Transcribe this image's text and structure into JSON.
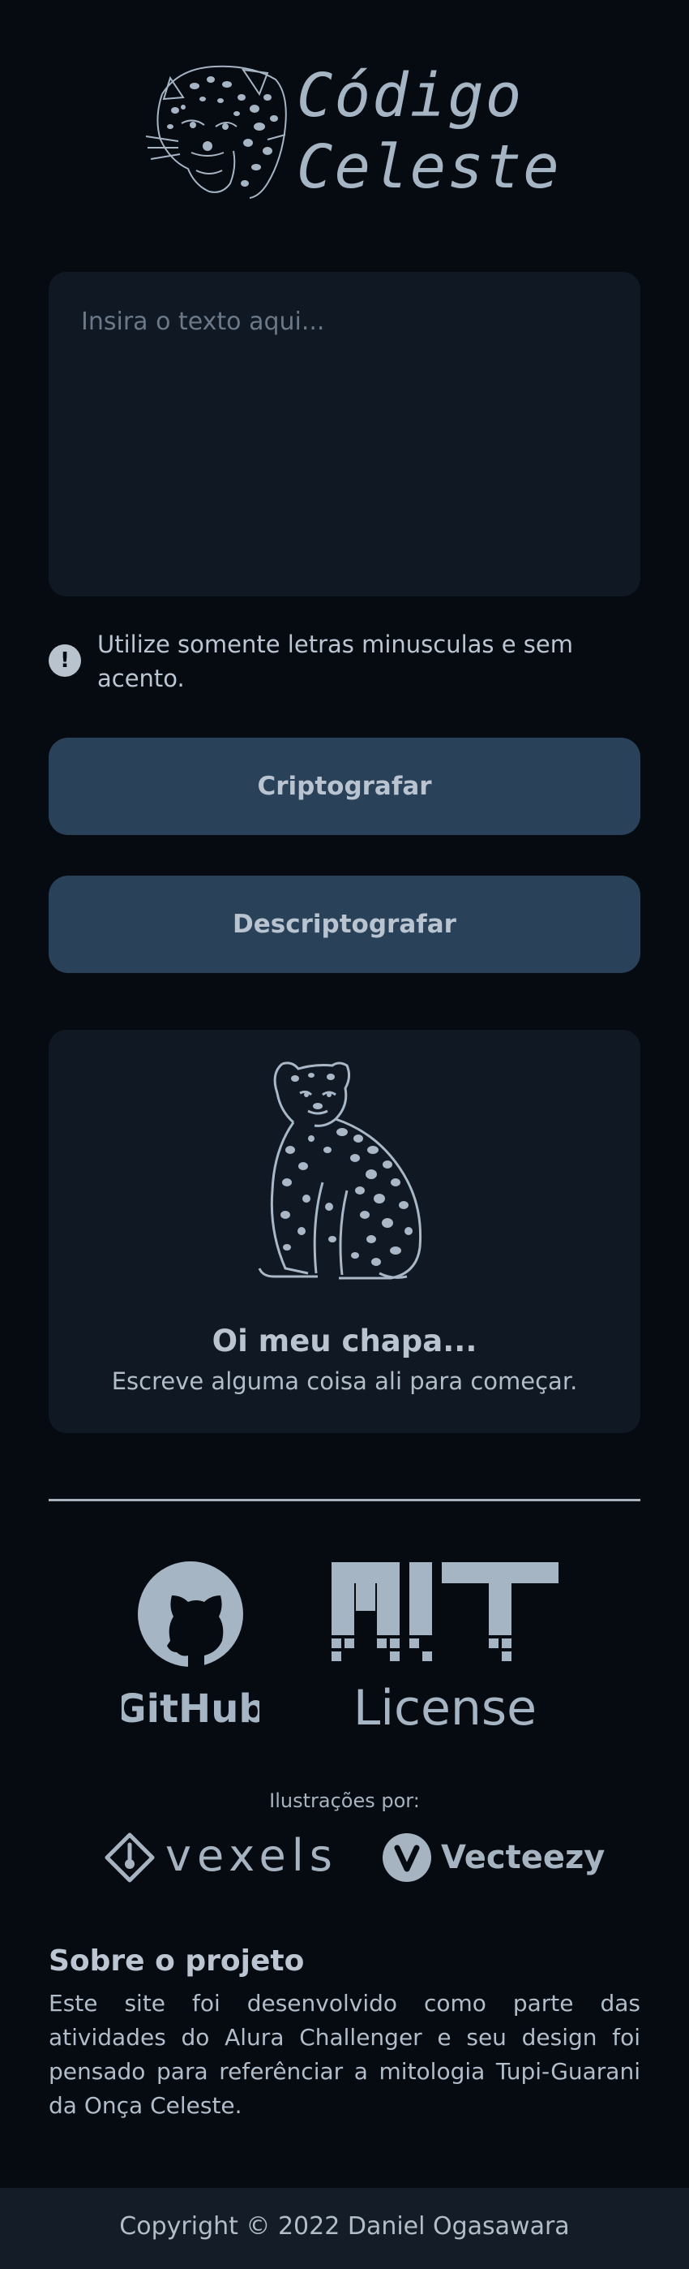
{
  "header": {
    "title_line1": "Código",
    "title_line2": "Celeste"
  },
  "input": {
    "placeholder": "Insira o texto aqui...",
    "value": ""
  },
  "warning": {
    "icon": "exclamation-icon",
    "text": "Utilize somente letras minusculas e sem acento."
  },
  "buttons": {
    "encrypt_label": "Criptografar",
    "decrypt_label": "Descriptografar"
  },
  "output": {
    "illustration": "sitting-jaguar-illustration",
    "title": "Oi meu chapa...",
    "subtitle": "Escreve alguma coisa ali para começar."
  },
  "badges": {
    "github_label": "GitHub",
    "mit_word": "MIT",
    "license_label": "License"
  },
  "illustrations": {
    "label": "Ilustrações por:",
    "vexels": "vexels",
    "vecteezy": "Vecteezy"
  },
  "about": {
    "title": "Sobre o projeto",
    "text": "Este site foi desenvolvido como parte das atividades do Alura Challenger e seu design foi pensado para referênciar a mitologia Tupi-Guarani da Onça Celeste."
  },
  "footer": {
    "copyright": "Copyright © 2022 Daniel Ogasawara"
  },
  "colors": {
    "background": "#060a11",
    "card": "#0f1823",
    "button": "#2a4259",
    "accent": "#a6b5c4"
  }
}
